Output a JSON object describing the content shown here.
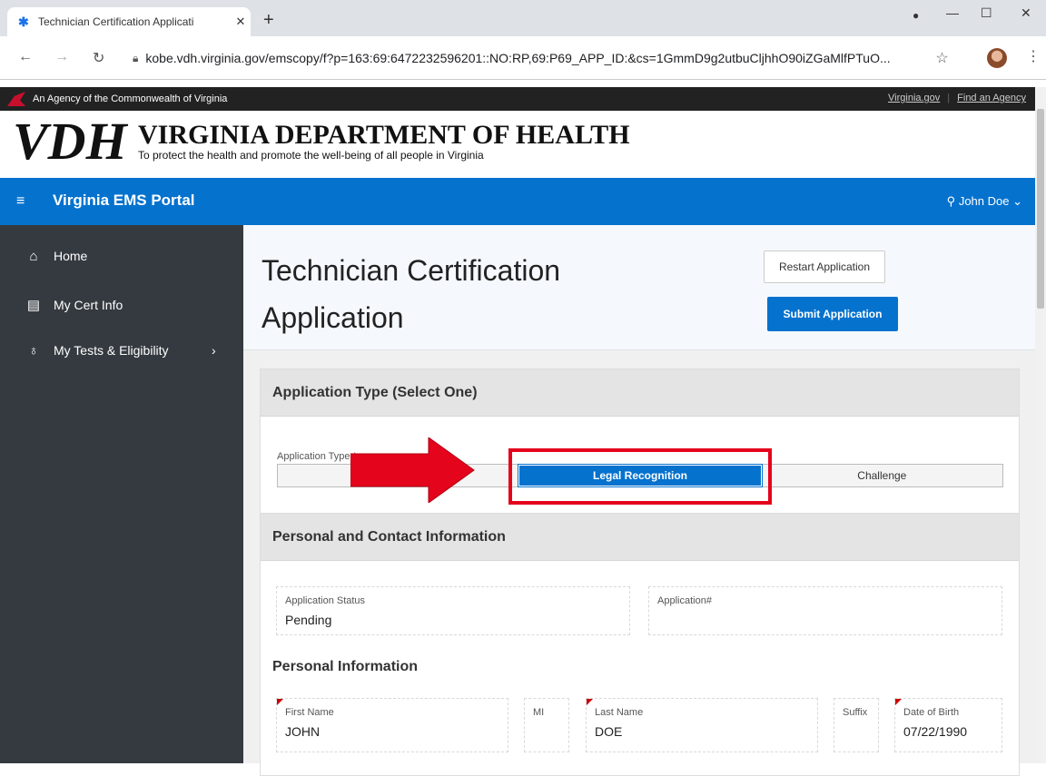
{
  "browser": {
    "tab_title": "Technician Certification Applicati",
    "tab_close": "✕",
    "new_tab": "+",
    "url": "kobe.vdh.virginia.gov/emscopy/f?p=163:69:6472232596201::NO:RP,69:P69_APP_ID:&cs=1GmmD9g2utbuCljhhO90iZGaMlfPTuO..."
  },
  "agency_bar": {
    "text": "An Agency of the Commonwealth of Virginia",
    "link_virginia": "Virginia.gov",
    "link_find": "Find an Agency"
  },
  "vdh": {
    "logo": "VDH",
    "name": "VIRGINIA DEPARTMENT OF HEALTH",
    "tagline": "To protect the health and promote the well-being of all people in Virginia"
  },
  "appbar": {
    "menu_icon": "≡",
    "title": "Virginia EMS Portal",
    "user": "John Doe"
  },
  "sidebar": {
    "items": [
      {
        "label": "Home",
        "icon": "home-icon"
      },
      {
        "label": "My Cert Info",
        "icon": "id-card-icon"
      },
      {
        "label": "My Tests & Eligibility",
        "icon": "award-icon"
      }
    ]
  },
  "page": {
    "title": "Technician Certification Application",
    "restart_label": "Restart Application",
    "submit_label": "Submit Application"
  },
  "app_type": {
    "heading": "Application Type (Select One)",
    "field_label": "Application Type",
    "required_mark": "*",
    "options": [
      "",
      "Legal Recognition",
      "Challenge"
    ],
    "selected": "Legal Recognition"
  },
  "personal": {
    "heading": "Personal and Contact Information",
    "status_label": "Application Status",
    "status_value": "Pending",
    "app_no_label": "Application#",
    "app_no_value": "",
    "sub_heading": "Personal Information",
    "first_name_label": "First Name",
    "first_name_value": "JOHN",
    "mi_label": "MI",
    "last_name_label": "Last Name",
    "last_name_value": "DOE",
    "suffix_label": "Suffix",
    "dob_label": "Date of Birth",
    "dob_value": "07/22/1990"
  },
  "colors": {
    "accent": "#0572ce",
    "sidebar": "#343a40",
    "highlight": "#e4041c"
  }
}
